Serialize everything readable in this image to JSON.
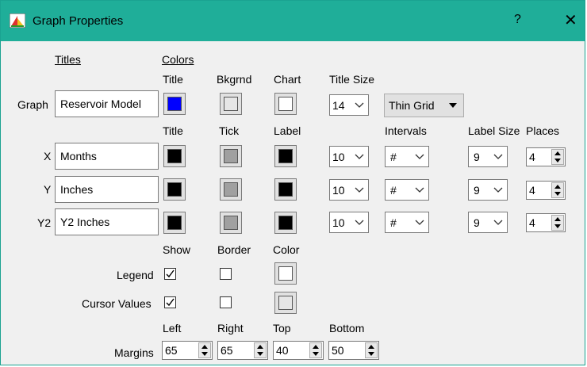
{
  "window": {
    "title": "Graph Properties",
    "help": "?",
    "close": "✕"
  },
  "headers": {
    "titles": "Titles",
    "colors": "Colors"
  },
  "graph_row": {
    "col_title": "Title",
    "col_bkgrnd": "Bkgrnd",
    "col_chart": "Chart",
    "col_title_size": "Title Size",
    "label": "Graph",
    "title_value": "Reservoir Model",
    "title_color": "#0000ff",
    "bkgrnd_color": "#e6e6e6",
    "chart_color": "#ffffff",
    "title_size": "14",
    "grid_option": "Thin Grid"
  },
  "axis_headers": {
    "title": "Title",
    "tick": "Tick",
    "label": "Label",
    "intervals": "Intervals",
    "label_size": "Label Size",
    "places": "Places"
  },
  "axes": [
    {
      "label": "X",
      "title_value": "Months",
      "title_color": "#000000",
      "tick_color": "#a0a0a0",
      "label_color": "#000000",
      "size": "10",
      "intervals": "#",
      "label_size": "9",
      "places": "4"
    },
    {
      "label": "Y",
      "title_value": "Inches",
      "title_color": "#000000",
      "tick_color": "#a0a0a0",
      "label_color": "#000000",
      "size": "10",
      "intervals": "#",
      "label_size": "9",
      "places": "4"
    },
    {
      "label": "Y2",
      "title_value": "Y2 Inches",
      "title_color": "#000000",
      "tick_color": "#a0a0a0",
      "label_color": "#000000",
      "size": "10",
      "intervals": "#",
      "label_size": "9",
      "places": "4"
    }
  ],
  "legend_headers": {
    "show": "Show",
    "border": "Border",
    "color": "Color"
  },
  "legend": {
    "label": "Legend",
    "show": true,
    "border": false,
    "color": "#ffffff"
  },
  "cursor_values": {
    "label": "Cursor Values",
    "show": true,
    "border": false,
    "color": "#e6e6e6"
  },
  "margin_headers": {
    "left": "Left",
    "right": "Right",
    "top": "Top",
    "bottom": "Bottom"
  },
  "margins": {
    "label": "Margins",
    "left": "65",
    "right": "65",
    "top": "40",
    "bottom": "50"
  }
}
